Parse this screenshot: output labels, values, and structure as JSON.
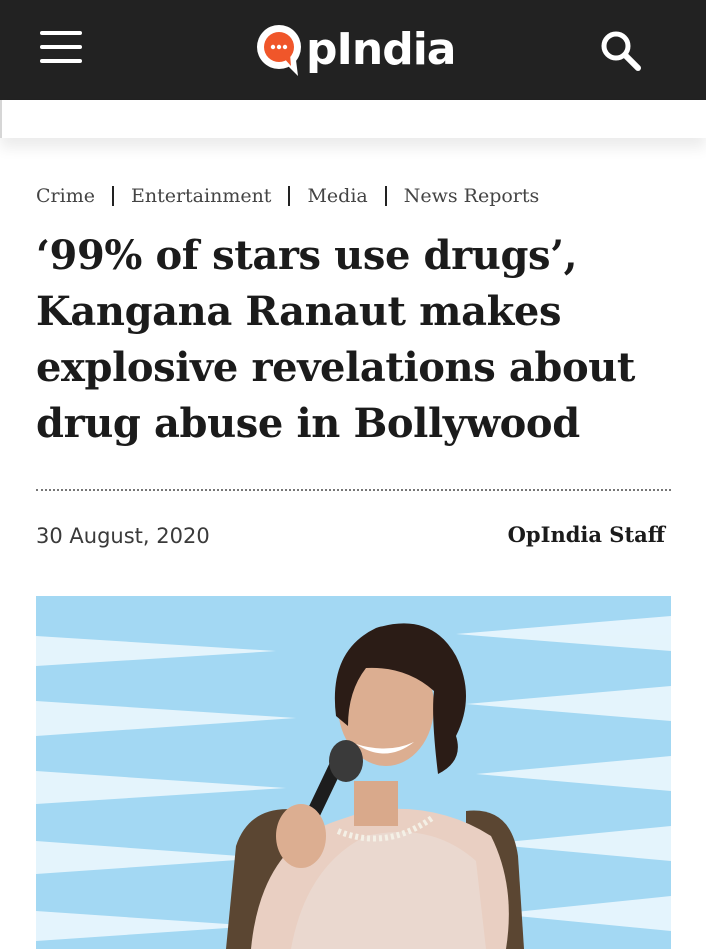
{
  "header": {
    "logo_text": "pIndia",
    "logo_mark": "OpIndia speech-bubble logo",
    "menu_icon": "hamburger-menu-icon",
    "search_icon": "search-icon",
    "colors": {
      "background": "#222222",
      "brand_orange": "#f0562a",
      "icon": "#ffffff"
    }
  },
  "breadcrumbs": [
    "Crime",
    "Entertainment",
    "Media",
    "News Reports"
  ],
  "article": {
    "title": "‘99% of stars use drugs’, Kangana Ranaut makes explosive revelations about drug abuse in Bollywood",
    "date": "30 August, 2020",
    "author": "OpIndia Staff"
  }
}
